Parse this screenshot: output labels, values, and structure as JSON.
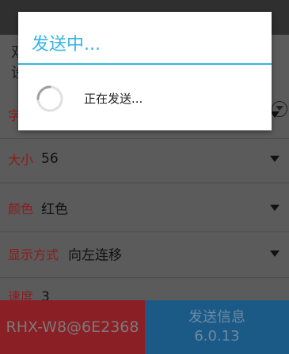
{
  "background": {
    "peek_line1": "双",
    "peek_line2": "设",
    "peek_line3": "字"
  },
  "settings": [
    {
      "label": "大小",
      "value": "56"
    },
    {
      "label": "颜色",
      "value": "红色"
    },
    {
      "label": "显示方式",
      "value": "向左连移"
    },
    {
      "label": "速度",
      "value": "3"
    }
  ],
  "bottom": {
    "device_label": "RHX-W8@6E2368",
    "send_label": "发送信息",
    "version": "6.0.13"
  },
  "dialog": {
    "title": "发送中...",
    "message": "正在发送..."
  },
  "colors": {
    "accent": "#33b5e5",
    "label_red": "#8e1b1b",
    "device_bg": "#8a1f25",
    "send_bg": "#1b5a87"
  }
}
